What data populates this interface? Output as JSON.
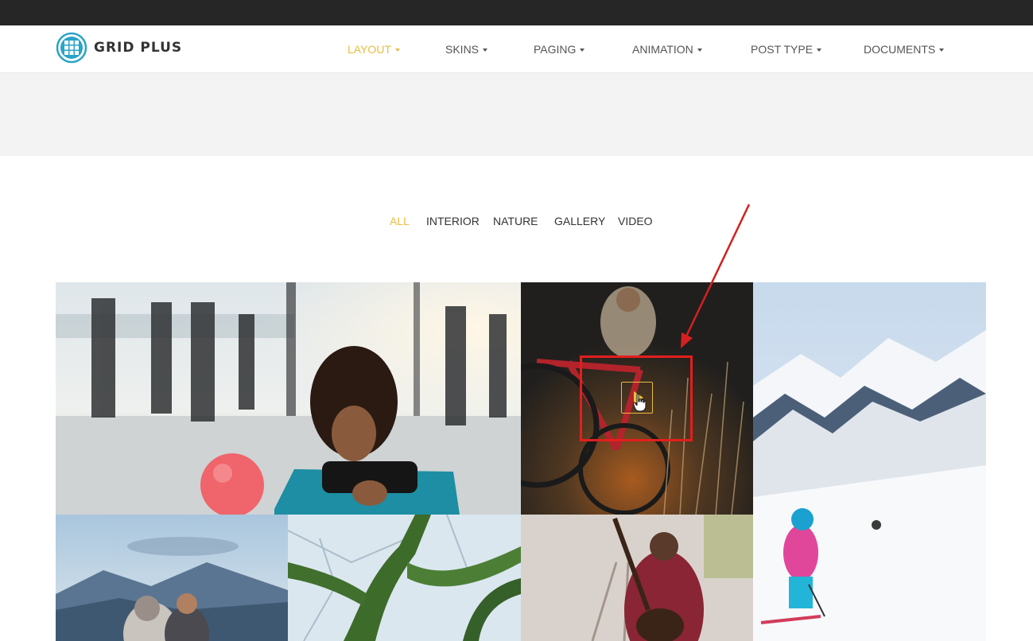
{
  "brand": {
    "name": "GRID PLUS",
    "accent": "#e9bc41",
    "logo_color": "#2aa3c6"
  },
  "nav": {
    "items": [
      {
        "label": "LAYOUT",
        "active": true
      },
      {
        "label": "SKINS",
        "active": false
      },
      {
        "label": "PAGING",
        "active": false
      },
      {
        "label": "ANIMATION",
        "active": false
      },
      {
        "label": "POST TYPE",
        "active": false
      },
      {
        "label": "DOCUMENTS",
        "active": false
      }
    ]
  },
  "filters": {
    "items": [
      {
        "label": "ALL",
        "active": true
      },
      {
        "label": "INTERIOR",
        "active": false
      },
      {
        "label": "NATURE",
        "active": false
      },
      {
        "label": "GALLERY",
        "active": false
      },
      {
        "label": "VIDEO",
        "active": false
      }
    ]
  },
  "gallery": {
    "items": [
      {
        "subject": "woman exercising with ball in gym"
      },
      {
        "subject": "cyclist with red bike at sunset",
        "type": "video"
      },
      {
        "subject": "skier on snowy mountains"
      },
      {
        "subject": "couple at mountain lake"
      },
      {
        "subject": "mossy tree branches"
      },
      {
        "subject": "man with guitar on railroad"
      }
    ]
  },
  "annotation": {
    "color": "#e31e1e"
  }
}
